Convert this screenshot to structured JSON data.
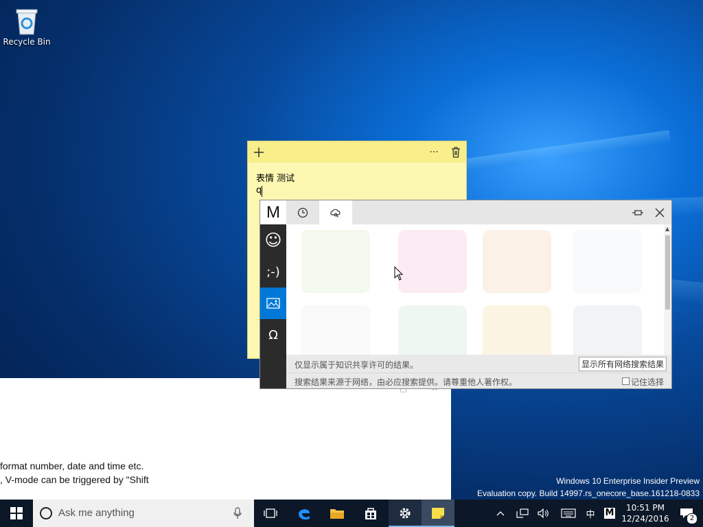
{
  "desktop": {
    "recycle_bin_label": "Recycle Bin"
  },
  "background_window": {
    "line1": "format number, date and time etc.",
    "line2": ", V-mode can be triggered by \"Shift"
  },
  "sticky_note": {
    "add_icon": "plus-icon",
    "more_label": "···",
    "delete_icon": "trash-icon",
    "text_line1": "表情 测试",
    "text_line2": "q"
  },
  "emoji_panel": {
    "logo": "M",
    "tabs": [
      {
        "icon": "clock-icon"
      },
      {
        "icon": "cloud-search-icon"
      }
    ],
    "side_buttons": [
      {
        "label": "☺",
        "icon": "smiley-icon"
      },
      {
        "label": ";-)",
        "icon": "emoticon-icon"
      },
      {
        "label": "",
        "icon": "image-icon"
      },
      {
        "label": "Ω",
        "icon": "omega-icon"
      }
    ],
    "notice": "仅显示属于知识共享许可的结果。",
    "show_all_button": "显示所有网络搜索结果",
    "source_note": "搜索结果来源于网络，由必应搜索提供。请尊重他人著作权。",
    "remember_label": "记住选择",
    "tile_colors": [
      "#dfeecb",
      "#f7c6d9",
      "#f3d7b8",
      "#e8eef3",
      "#eeeeee",
      "#cfe8d8",
      "#f6e0b0",
      "#d9dde3"
    ]
  },
  "watermark": {
    "line1": "Windows 10 Enterprise Insider Preview",
    "line2": "Evaluation copy. Build 14997.rs_onecore_base.161218-0833"
  },
  "taskbar": {
    "search_placeholder": "Ask me anything",
    "ime_lang": "中",
    "ime_mode": "M",
    "time": "10:51 PM",
    "date": "12/24/2016",
    "notification_count": "2"
  },
  "colors": {
    "accent": "#0078d7",
    "sticky": "#fcf7b1",
    "sticky_bar": "#f8ee8a",
    "taskbar": "#0c1727"
  }
}
